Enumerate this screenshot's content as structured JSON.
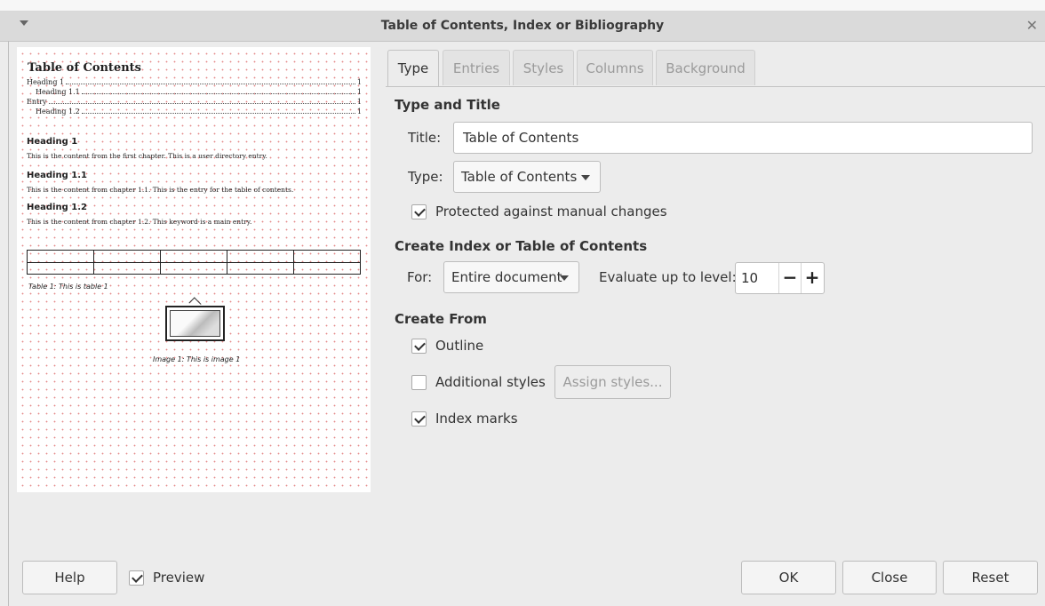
{
  "window": {
    "title": "Table of Contents, Index or Bibliography"
  },
  "preview": {
    "title": "Table of Contents",
    "toc_entries": [
      {
        "text": "Heading 1",
        "page": "1"
      },
      {
        "text": "Heading 1.1",
        "page": "1"
      },
      {
        "text": "Entry",
        "page": "1"
      },
      {
        "text": "Heading 1.2",
        "page": "1"
      }
    ],
    "headings": [
      "Heading 1",
      "Heading 1.1",
      "Heading 1.2"
    ],
    "paragraphs": [
      "This is the content from the first chapter. This is a user directory entry.",
      "This is the content from chapter 1.1. This is the entry for the table of contents.",
      "This is the content from chapter 1.2. This keyword is a main entry."
    ],
    "table_caption": "Table 1: This is table 1",
    "image_caption": "Image 1: This is image 1"
  },
  "tabs": [
    "Type",
    "Entries",
    "Styles",
    "Columns",
    "Background"
  ],
  "type_and_title": {
    "heading": "Type and Title",
    "title_label": "Title:",
    "title_value": "Table of Contents",
    "type_label": "Type:",
    "type_value": "Table of Contents",
    "protected_label": "Protected against manual changes",
    "protected_checked": true
  },
  "create_index": {
    "heading": "Create Index or Table of Contents",
    "for_label": "For:",
    "for_value": "Entire document",
    "evaluate_label": "Evaluate up to level:",
    "level": "10",
    "minus": "−",
    "plus": "+"
  },
  "create_from": {
    "heading": "Create From",
    "outline": "Outline",
    "additional_styles": "Additional styles",
    "assign_styles": "Assign styles...",
    "index_marks": "Index marks"
  },
  "footer": {
    "help": "Help",
    "preview": "Preview",
    "ok": "OK",
    "close": "Close",
    "reset": "Reset"
  }
}
